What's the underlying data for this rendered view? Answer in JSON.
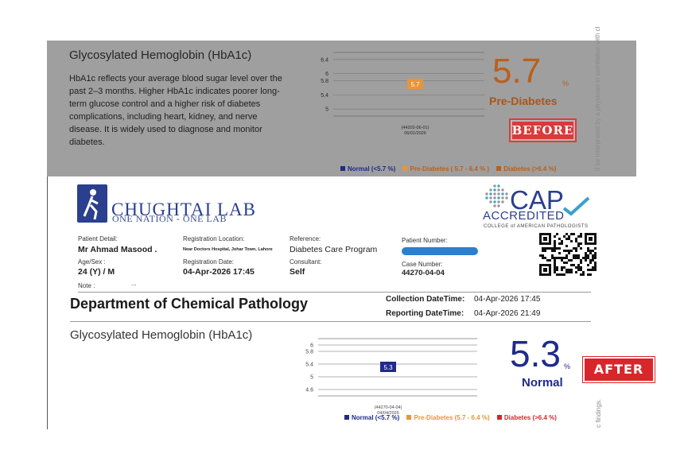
{
  "before": {
    "title": "Glycosylated Hemoglobin (HbA1c)",
    "description": "HbA1c reflects your average blood sugar level over the past 2–3 months. Higher HbA1c indicates poorer long-term glucose control and a higher risk of diabetes complications, including heart, kidney, and nerve disease. It is widely used to diagnose and monitor diabetes.",
    "value": "5.7",
    "unit": "%",
    "status": "Pre-Diabetes",
    "stamp": "BEFORE",
    "side_text": "d be interpreted by a physician in correlation with cl",
    "legend": {
      "normal": "Normal (<5.7 %)",
      "pre": "Pre-Diabetes ( 5.7 - 6.4 % )",
      "diabetes": "Diabetes (>6.4 %)"
    }
  },
  "report": {
    "lab_name": "CHUGHTAI LAB",
    "lab_tagline": "ONE NATION - ONE LAB",
    "cap": "CAP",
    "accredited": "ACCREDITED",
    "college": "COLLEGE of AMERICAN PATHOLOGISTS",
    "patient_detail_label": "Patient Detail:",
    "patient_name": "Mr Ahmad Masood .",
    "agesex_label": "Age/Sex :",
    "agesex": "24 (Y) / M",
    "note_label": "Note :",
    "note_value": "...",
    "reg_location_label": "Registration Location:",
    "reg_location": "Near Doctors Hospital, Johar Town, Lahore",
    "reg_date_label": "Registration Date:",
    "reg_date": "04-Apr-2026 17:45",
    "reference_label": "Reference:",
    "reference": "Diabetes Care Program",
    "consultant_label": "Consultant:",
    "consultant": "Self",
    "patient_number_label": "Patient Number:",
    "case_number_label": "Case Number:",
    "case_number": "44270-04-04",
    "department": "Department of Chemical Pathology",
    "collection_label": "Collection DateTime:",
    "collection_value": "04-Apr-2026 17:45",
    "reporting_label": "Reporting DateTime:",
    "reporting_value": "04-Apr-2026 21:49",
    "side_text": "c findings."
  },
  "after": {
    "title": "Glycosylated Hemoglobin (HbA1c)",
    "value": "5.3",
    "unit": "%",
    "status": "Normal",
    "stamp": "AFTER",
    "legend": {
      "normal": "Normal (<5.7 %)",
      "pre": "Pre-Diabetes (5.7 - 6.4 %)",
      "diabetes": "Diabetes (>6.4 %)"
    }
  },
  "colors": {
    "normal": "#1f2a8a",
    "pre": "#e8943a",
    "diabetes": "#d8262a"
  },
  "chart_data": [
    {
      "type": "bar",
      "categories": [
        "(44202-06-01)\n06/01/2026"
      ],
      "values": [
        5.7
      ],
      "data_label": "5.7",
      "ticks": [
        5,
        5.4,
        5.8,
        6,
        6.4
      ],
      "ylim": [
        4.8,
        6.6
      ],
      "bar_color": "#e8943a"
    },
    {
      "type": "bar",
      "categories": [
        "(44270-04-04)\n04/04/2026"
      ],
      "values": [
        5.3
      ],
      "data_label": "5.3",
      "ticks": [
        4.6,
        5,
        5.4,
        5.8,
        6
      ],
      "ylim": [
        4.4,
        6.2
      ],
      "bar_color": "#1f2a8a"
    }
  ]
}
